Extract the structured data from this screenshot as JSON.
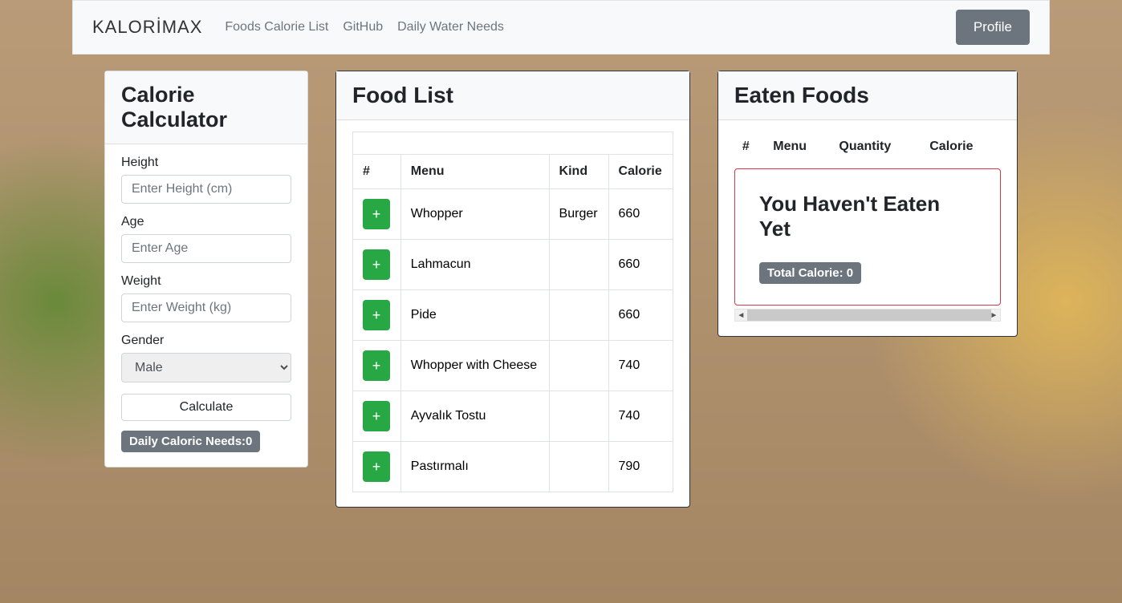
{
  "nav": {
    "brand": "KALORİMAX",
    "links": [
      "Foods Calorie List",
      "GitHub",
      "Daily Water Needs"
    ],
    "profile": "Profile"
  },
  "calc": {
    "title": "Calorie Calculator",
    "height_label": "Height",
    "height_ph": "Enter Height (cm)",
    "age_label": "Age",
    "age_ph": "Enter Age",
    "weight_label": "Weight",
    "weight_ph": "Enter Weight (kg)",
    "gender_label": "Gender",
    "gender_value": "Male",
    "calculate": "Calculate",
    "result": "Daily Caloric Needs:0"
  },
  "foodlist": {
    "title": "Food List",
    "headers": {
      "num": "#",
      "menu": "Menu",
      "kind": "Kind",
      "calorie": "Calorie"
    },
    "plus": "+",
    "rows": [
      {
        "menu": "Whopper",
        "kind": "Burger",
        "calorie": "660"
      },
      {
        "menu": "Lahmacun",
        "kind": "",
        "calorie": "660"
      },
      {
        "menu": "Pide",
        "kind": "",
        "calorie": "660"
      },
      {
        "menu": "Whopper with Cheese",
        "kind": "",
        "calorie": "740"
      },
      {
        "menu": "Ayvalık Tostu",
        "kind": "",
        "calorie": "740"
      },
      {
        "menu": "Pastırmalı",
        "kind": "",
        "calorie": "790"
      }
    ]
  },
  "eaten": {
    "title": "Eaten Foods",
    "headers": {
      "num": "#",
      "menu": "Menu",
      "qty": "Quantity",
      "calorie": "Calorie"
    },
    "empty_title": "You Haven't Eaten Yet",
    "total": "Total Calorie: 0"
  }
}
